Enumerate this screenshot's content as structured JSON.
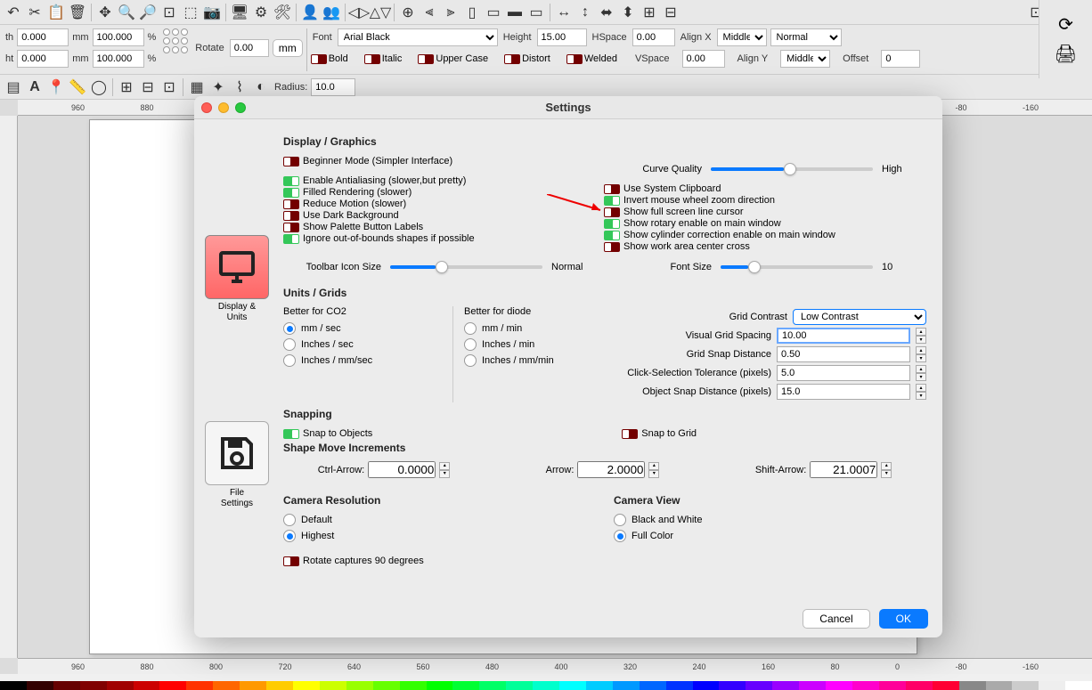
{
  "toolbar": {
    "width_label": "th",
    "width_val": "0.000",
    "unit_mm": "mm",
    "w100": "100.000",
    "pct": "%",
    "height_label": "ht",
    "height_val": "0.000",
    "h100": "100.000",
    "rotate_label": "Rotate",
    "rotate_val": "0.00",
    "mm_btn": "mm",
    "font_label": "Font",
    "font_val": "Arial Black",
    "height2_label": "Height",
    "height2_val": "15.00",
    "hspace_label": "HSpace",
    "hspace_val": "0.00",
    "vspace_label": "VSpace",
    "vspace_val": "0.00",
    "alignx_label": "Align X",
    "alignx_val": "Middle",
    "aligny_label": "Align Y",
    "aligny_val": "Middle",
    "offset_label": "Offset",
    "offset_val": "0",
    "normal_val": "Normal",
    "bold": "Bold",
    "italic": "Italic",
    "upper": "Upper Case",
    "distort": "Distort",
    "welded": "Welded",
    "radius_label": "Radius:",
    "radius_val": "10.0"
  },
  "ruler": {
    "ticks": [
      "960",
      "880",
      "800",
      "720",
      "640",
      "560",
      "480",
      "400",
      "320",
      "240",
      "160",
      "80",
      "0",
      "-80",
      "-160"
    ]
  },
  "dialog": {
    "title": "Settings",
    "sidebar": {
      "tab1": "Display &\nUnits",
      "tab2": "File\nSettings"
    },
    "sections": {
      "display_graphics": "Display / Graphics",
      "units_grids": "Units / Grids",
      "snapping": "Snapping",
      "shape_move": "Shape Move Increments",
      "camera_res": "Camera Resolution",
      "camera_view": "Camera View"
    },
    "toggles": {
      "beginner": "Beginner Mode (Simpler Interface)",
      "antialias": "Enable Antialiasing (slower,but pretty)",
      "filled": "Filled Rendering (slower)",
      "reduce_motion": "Reduce Motion (slower)",
      "dark_bg": "Use Dark Background",
      "palette_labels": "Show Palette Button Labels",
      "ignore_oob": "Ignore out-of-bounds shapes if possible",
      "sys_clip": "Use System Clipboard",
      "invert_wheel": "Invert mouse wheel zoom direction",
      "fullscreen_cursor": "Show full screen line cursor",
      "rotary_main": "Show rotary enable on main window",
      "cylinder_main": "Show cylinder correction enable on main window",
      "work_center": "Show work area center cross",
      "snap_objects": "Snap to Objects",
      "snap_grid": "Snap to Grid",
      "rotate_captures": "Rotate captures 90 degrees"
    },
    "sliders": {
      "curve_quality_label": "Curve Quality",
      "curve_quality_val": "High",
      "toolbar_icon_label": "Toolbar Icon Size",
      "toolbar_icon_val": "Normal",
      "font_size_label": "Font Size",
      "font_size_val": "10"
    },
    "units": {
      "better_co2": "Better for CO2",
      "better_diode": "Better for diode",
      "mm_sec": "mm / sec",
      "in_sec": "Inches / sec",
      "in_mm_sec": "Inches / mm/sec",
      "mm_min": "mm / min",
      "in_min": "Inches / min",
      "in_mm_min": "Inches / mm/min"
    },
    "grid": {
      "contrast_label": "Grid Contrast",
      "contrast_val": "Low Contrast",
      "visual_spacing_label": "Visual Grid Spacing",
      "visual_spacing_val": "10.00",
      "snap_dist_label": "Grid Snap Distance",
      "snap_dist_val": "0.50",
      "click_tol_label": "Click-Selection Tolerance (pixels)",
      "click_tol_val": "5.0",
      "obj_snap_label": "Object Snap Distance (pixels)",
      "obj_snap_val": "15.0"
    },
    "arrows": {
      "ctrl_label": "Ctrl-Arrow:",
      "ctrl_val": "0.0000",
      "arrow_label": "Arrow:",
      "arrow_val": "2.0000",
      "shift_label": "Shift-Arrow:",
      "shift_val": "21.0007"
    },
    "camera": {
      "default": "Default",
      "highest": "Highest",
      "bw": "Black and White",
      "full_color": "Full Color"
    },
    "buttons": {
      "cancel": "Cancel",
      "ok": "OK"
    }
  },
  "colors": [
    "#000",
    "#330000",
    "#660000",
    "#800000",
    "#a00000",
    "#c00",
    "#f00",
    "#f30",
    "#f60",
    "#f90",
    "#fc0",
    "#ff0",
    "#cf0",
    "#9f0",
    "#6f0",
    "#3f0",
    "#0f0",
    "#0f3",
    "#0f6",
    "#0f9",
    "#0fc",
    "#0ff",
    "#0cf",
    "#09f",
    "#06f",
    "#03f",
    "#00f",
    "#30f",
    "#60f",
    "#90f",
    "#c0f",
    "#f0f",
    "#f0c",
    "#f09",
    "#f06",
    "#f03",
    "#888",
    "#aaa",
    "#ccc",
    "#eee",
    "#fff"
  ]
}
